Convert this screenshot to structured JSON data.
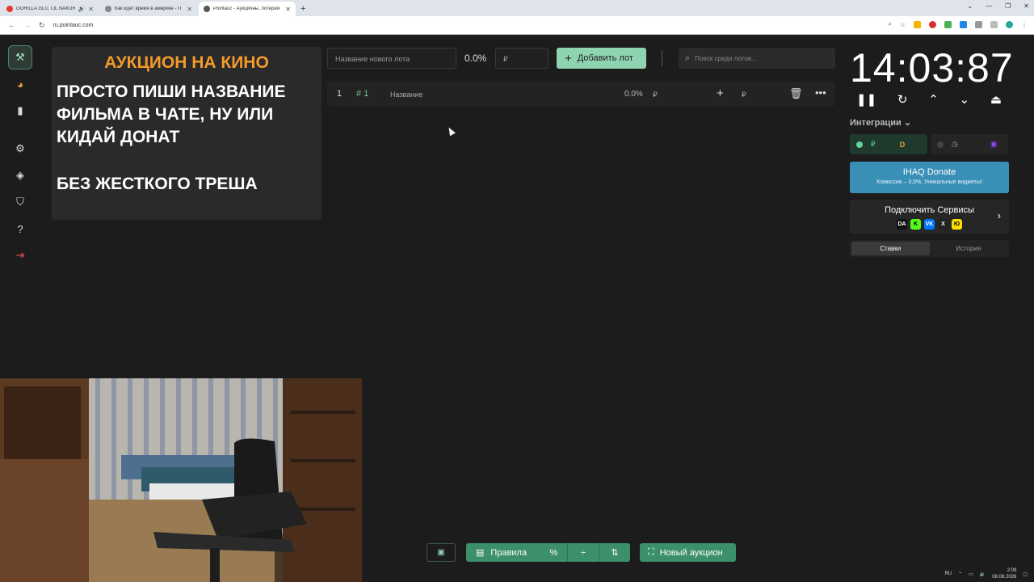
{
  "browser": {
    "tabs": [
      {
        "title": "GORILLA GLU, LIL NAKUR",
        "fav": "#e53935",
        "sound": true
      },
      {
        "title": "Как идет время в америке - П",
        "fav": "#888888",
        "sound": false
      },
      {
        "title": "Pointauc - Аукционы, лотерея",
        "fav": "#555555",
        "sound": false
      }
    ],
    "new_tab": "+",
    "url": "ru.pointauc.com"
  },
  "overlay": {
    "title": "АУКЦИОН НА КИНО",
    "body": "ПРОСТО ПИШИ НАЗВАНИЕ ФИЛЬМА В ЧАТЕ, НУ ИЛИ КИДАЙ ДОНАТ",
    "footer": "БЕЗ ЖЕСТКОГО ТРЕША"
  },
  "lot_form": {
    "name_placeholder": "Название нового лота",
    "percent": "0.0%",
    "amount_placeholder": "₽",
    "add_label": "Добавить лот",
    "search_placeholder": "Поиск среди лотов..."
  },
  "lot": {
    "index": "1",
    "id": "# 1",
    "name_placeholder": "Название",
    "percent": "0.0%",
    "currency": "₽",
    "add_currency": "₽"
  },
  "timer": {
    "value": "14:03:87"
  },
  "integrations": {
    "label": "Интеграции",
    "donate_currency": "₽",
    "donate_brand": "D"
  },
  "ihaq": {
    "title": "IHAQ Donate",
    "subtitle": "Комиссия – 3,5%. Уникальные виджеты!"
  },
  "connect": {
    "title": "Подключить Сервисы",
    "icons": [
      "DA",
      "K",
      "VK",
      "X",
      "Ю"
    ]
  },
  "bets_tabs": {
    "bets": "Ставки",
    "history": "История"
  },
  "toolbar": {
    "rules": "Правила",
    "new_auction": "Новый аукцион"
  },
  "tray": {
    "lang": "RU",
    "time": "2:09",
    "date": "08.08.2026"
  }
}
